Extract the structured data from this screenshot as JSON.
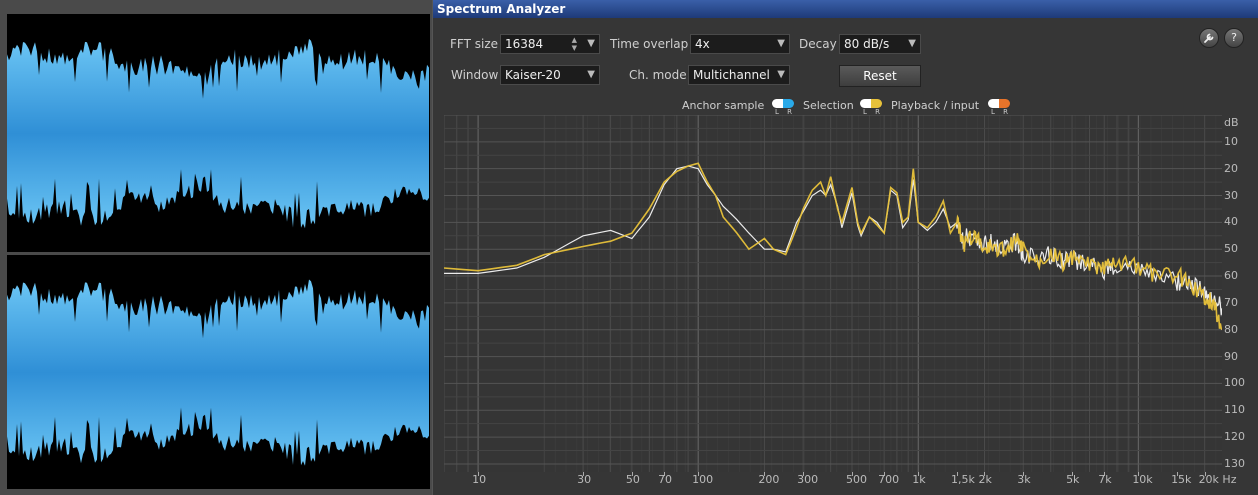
{
  "window_title": "Spectrum Analyzer",
  "controls": {
    "fft_size_label": "FFT size",
    "fft_size_value": "16384",
    "time_overlap_label": "Time overlap",
    "time_overlap_value": "4x",
    "decay_label": "Decay",
    "decay_value": "80 dB/s",
    "window_label": "Window",
    "window_value": "Kaiser-20",
    "ch_mode_label": "Ch. mode",
    "ch_mode_value": "Multichannel",
    "reset_label": "Reset"
  },
  "legend": [
    {
      "label": "Anchor sample",
      "color_l": "#ffffff",
      "color_r": "#29a9e8"
    },
    {
      "label": "Selection",
      "color_l": "#ffffff",
      "color_r": "#e8c23a"
    },
    {
      "label": "Playback / input",
      "color_l": "#ffffff",
      "color_r": "#e8742a"
    }
  ],
  "lr_label": "L R",
  "tool_icons": {
    "wrench": "wrench-icon",
    "help": "?"
  },
  "colors": {
    "waveform": "#4fb3ec",
    "selection": "#e8c23a",
    "anchor": "#ffffff"
  },
  "chart_data": {
    "type": "line",
    "x_scale": "log",
    "xlim": [
      7,
      24000
    ],
    "ylim": [
      0,
      133
    ],
    "y_unit": "dB",
    "y_ticks": [
      "dB",
      "10",
      "20",
      "30",
      "40",
      "50",
      "60",
      "70",
      "80",
      "90",
      "100",
      "110",
      "120",
      "130"
    ],
    "x_ticks": [
      "10",
      "30",
      "50",
      "70",
      "100",
      "200",
      "300",
      "500",
      "700",
      "1k",
      "1,5k",
      "2k",
      "3k",
      "5k",
      "7k",
      "10k",
      "15k",
      "20k Hz"
    ],
    "series": [
      {
        "key": "selection",
        "x": [
          7,
          10,
          15,
          20,
          30,
          40,
          50,
          60,
          70,
          80,
          90,
          100,
          110,
          120,
          130,
          150,
          170,
          200,
          220,
          250,
          280,
          300,
          330,
          360,
          380,
          400,
          430,
          450,
          480,
          500,
          530,
          550,
          600,
          650,
          700,
          750,
          800,
          850,
          900,
          950,
          1000,
          1100,
          1200,
          1300,
          1400,
          1500,
          1600,
          1800,
          2000,
          2200,
          2500,
          2800,
          3000,
          3500,
          4000,
          4500,
          5000,
          6000,
          7000,
          8000,
          10000,
          12000,
          15000,
          17000,
          20000,
          22000,
          24000
        ],
        "y": [
          57,
          58,
          56,
          52,
          49,
          47,
          44,
          35,
          25,
          21,
          19,
          18,
          25,
          30,
          38,
          44,
          50,
          46,
          50,
          52,
          42,
          35,
          28,
          25,
          30,
          23,
          35,
          40,
          32,
          27,
          40,
          44,
          38,
          41,
          44,
          27,
          29,
          40,
          38,
          20,
          40,
          42,
          38,
          32,
          44,
          40,
          48,
          44,
          50,
          48,
          52,
          46,
          50,
          54,
          50,
          55,
          53,
          56,
          57,
          55,
          57,
          59,
          60,
          62,
          68,
          70,
          80
        ]
      },
      {
        "key": "anchor",
        "x": [
          7,
          10,
          15,
          20,
          30,
          40,
          50,
          60,
          70,
          80,
          90,
          100,
          110,
          120,
          130,
          150,
          170,
          200,
          220,
          250,
          280,
          300,
          330,
          360,
          380,
          400,
          430,
          450,
          480,
          500,
          530,
          550,
          600,
          650,
          700,
          750,
          800,
          850,
          900,
          950,
          1000,
          1100,
          1200,
          1300,
          1400,
          1500,
          1600,
          1800,
          2000,
          2200,
          2500,
          2800,
          3000,
          3500,
          4000,
          4500,
          5000,
          6000,
          7000,
          8000,
          10000,
          12000,
          15000,
          17000,
          20000,
          22000,
          24000
        ],
        "y": [
          59,
          59,
          57,
          53,
          45,
          43,
          46,
          38,
          26,
          20,
          19,
          20,
          26,
          30,
          34,
          39,
          44,
          50,
          50,
          51,
          40,
          36,
          30,
          28,
          30,
          26,
          34,
          42,
          34,
          29,
          41,
          45,
          38,
          40,
          44,
          28,
          30,
          42,
          39,
          24,
          40,
          43,
          40,
          35,
          42,
          40,
          46,
          45,
          48,
          47,
          50,
          47,
          52,
          53,
          52,
          54,
          54,
          56,
          58,
          56,
          58,
          60,
          62,
          63,
          66,
          68,
          72
        ]
      }
    ]
  }
}
